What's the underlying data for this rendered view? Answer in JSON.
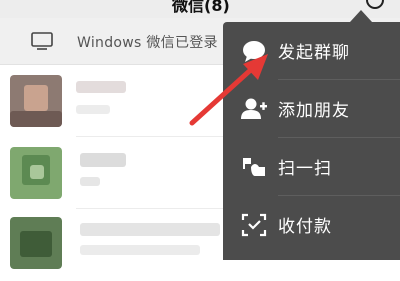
{
  "status_bar": {
    "title": "微信(8)"
  },
  "banner": {
    "icon": "monitor-icon",
    "text": "Windows 微信已登录"
  },
  "menu": {
    "items": [
      {
        "label": "发起群聊",
        "icon": "chat-bubble-icon"
      },
      {
        "label": "添加朋友",
        "icon": "add-friend-icon"
      },
      {
        "label": "扫一扫",
        "icon": "scan-icon"
      },
      {
        "label": "收付款",
        "icon": "payment-icon"
      }
    ]
  },
  "chats": [
    {
      "avatar": "blurred-avatar"
    },
    {
      "avatar": "blurred-avatar"
    },
    {
      "avatar": "blurred-avatar"
    }
  ],
  "colors": {
    "menu_bg": "#4c4c4c",
    "annotation_arrow": "#e53935",
    "banner_bg": "#f0f0f0"
  }
}
